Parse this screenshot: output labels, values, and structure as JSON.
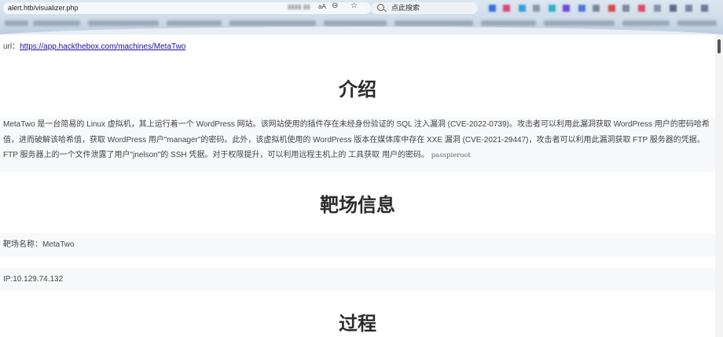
{
  "browser": {
    "address": "alert.htb/visualizer.php",
    "search_placeholder": "点此搜索",
    "reader_label": "aA"
  },
  "page": {
    "url_label": "url：",
    "url_link": "https://app.hackthebox.com/machines/MetaTwo",
    "section_intro": "介绍",
    "intro_text": "MetaTwo 是一台简易的 Linux 虚拟机，其上运行着一个 WordPress 网站。该网站使用的插件存在未经身份验证的 SQL 注入漏洞 (CVE-2022-0739)。攻击者可以利用此漏洞获取 WordPress 用户的密码哈希值，进而破解该哈希值，获取 WordPress 用户\"manager\"的密码。此外，该虚拟机使用的 WordPress 版本在媒体库中存在 XXE 漏洞 (CVE-2021-29447)，攻击者可以利用此漏洞获取 FTP 服务器的凭据。FTP 服务器上的一个文件泄露了用户\"jnelson\"的 SSH 凭据。对于权限提升，可以利用远程主机上的 工具获取 用户的密码。",
    "intro_code": "passpieroot",
    "section_info": "靶场信息",
    "machine_name": "靶场名称：MetaTwo",
    "ip": "IP:10.129.74.132",
    "section_process": "过程"
  }
}
